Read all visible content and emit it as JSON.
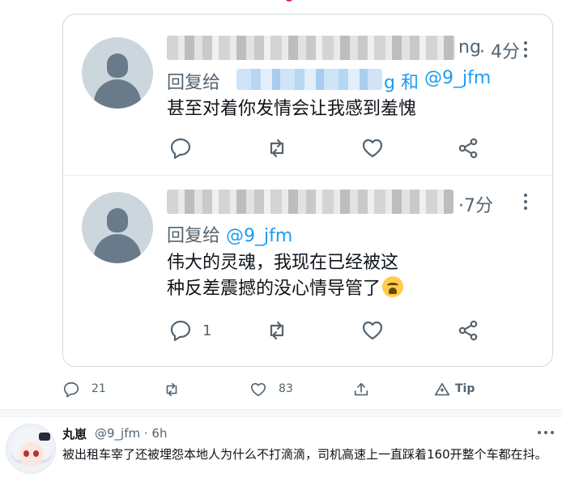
{
  "embed": {
    "reply1": {
      "name_suffix": "ng",
      "time": "· 4分",
      "reply_to_label": "回复给",
      "reply_to_tail": "g 和",
      "reply_to_mention": "@9_jfm",
      "text": "甚至对着你发情会让我感到羞愧"
    },
    "reply2": {
      "time": "·7分",
      "reply_to_label": "回复给",
      "reply_to_mention": "@9_jfm",
      "text": "伟大的灵魂，我现在已经被这种反差震撼的没心情导管了",
      "reply_count": "1"
    }
  },
  "footer": {
    "reply_count": "21",
    "like_count": "83",
    "tip_label": "Tip"
  },
  "bottom_tweet": {
    "name": "丸崽",
    "handle_time": "@9_jfm · 6h",
    "text": "被出租车宰了还被埋怨本地人为什么不打滴滴，司机高速上一直踩着160开整个车都在抖。"
  },
  "colors": {
    "accent": "#1d9bf0",
    "secondary_text": "#536471",
    "border": "#cfd9de"
  },
  "icons": [
    "reply-icon",
    "retweet-icon",
    "like-icon",
    "share-icon",
    "more-icon",
    "tip-icon",
    "crying-face-emoji"
  ]
}
